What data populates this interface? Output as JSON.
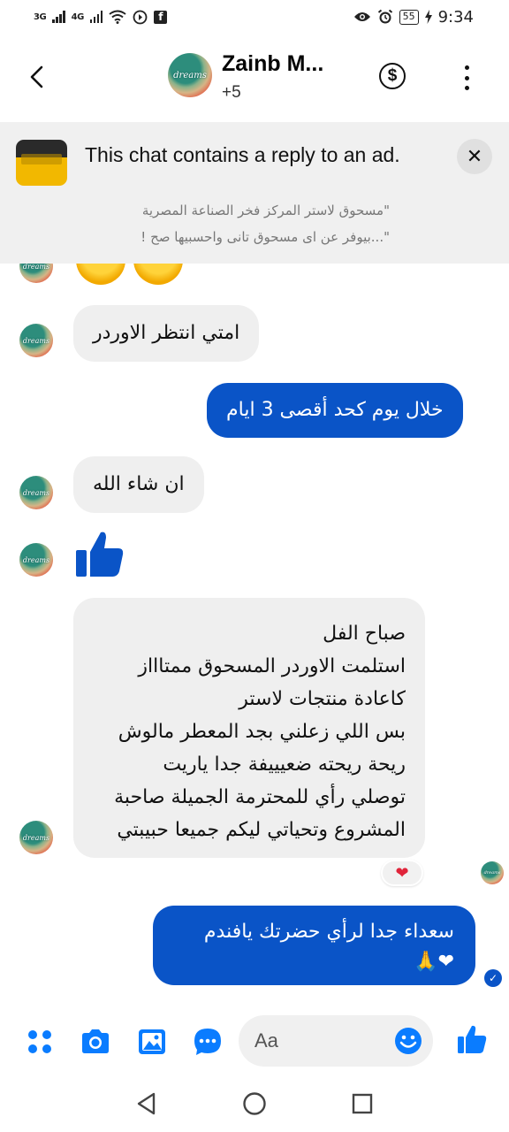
{
  "status_bar": {
    "network_1": "3G",
    "network_2": "4G",
    "battery": "55",
    "time": "9:34",
    "icons": [
      "signal-icon",
      "wifi-icon",
      "data-saver-icon",
      "facebook-icon",
      "eye-icon",
      "alarm-icon",
      "battery-icon",
      "charging-icon"
    ]
  },
  "header": {
    "contact_name": "Zainb M...",
    "participants": "+5",
    "avatar_text": "dreams",
    "icons": [
      "back-icon",
      "dollar-icon",
      "more-icon"
    ]
  },
  "ad_banner": {
    "title": "This chat contains a reply to an ad.",
    "quote_line_1": "\"مسحوق لاستر المركز فخر الصناعة المصرية",
    "quote_line_2": "\"...بيوفر عن اى مسحوق تانى واحسبيها صح !",
    "close_label": "✕"
  },
  "messages": [
    {
      "direction": "in",
      "text": "امتي انتظر الاوردر"
    },
    {
      "direction": "out",
      "text": "خلال يوم كحد أقصى 3 ايام"
    },
    {
      "direction": "in",
      "text": "ان شاء الله"
    },
    {
      "direction": "in",
      "type": "like"
    },
    {
      "direction": "in",
      "lines": [
        "صباح الفل",
        "استلمت الاوردر المسحوق ممتاااز",
        "كاعادة منتجات لاستر",
        "بس اللي زعلني بجد المعطر مالوش",
        "ريحة ريحته ضعيييفة جدا ياريت",
        "توصلي رأي للمحترمة الجميلة صاحبة",
        "المشروع وتحياتي ليكم جميعا حبيبتي"
      ],
      "reaction": "❤"
    },
    {
      "direction": "out",
      "lines": [
        "سعداء جدا لرأي حضرتك يافندم",
        "❤🙏"
      ]
    }
  ],
  "composer": {
    "placeholder": "Aa",
    "icons": [
      "menu-icon",
      "camera-icon",
      "gallery-icon",
      "chat-bubble-icon",
      "emoji-icon",
      "like-icon"
    ]
  },
  "colors": {
    "accent": "#0a7cff",
    "outgoing_bubble": "#0a54c7",
    "incoming_bubble": "#efefef",
    "banner_bg": "#f0f0f0"
  }
}
